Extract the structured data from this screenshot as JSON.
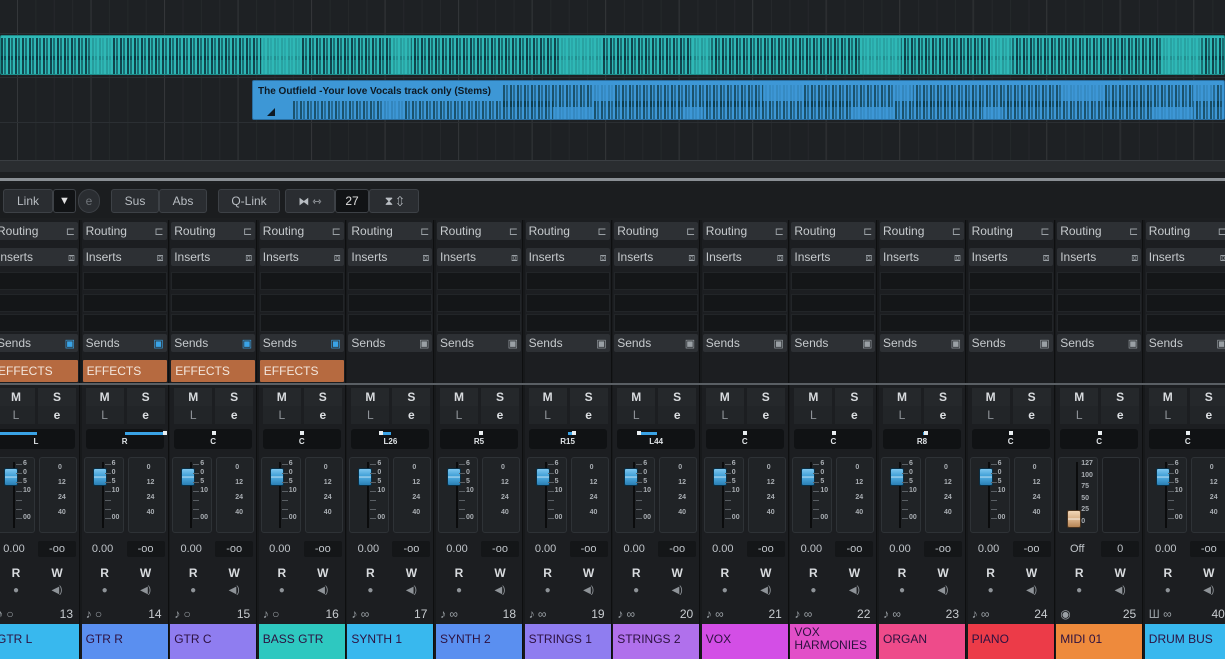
{
  "arrange": {
    "clip2_title": "The Outfield -Your love Vocals track only (Stems)"
  },
  "toolbar": {
    "link_label": "Link",
    "dropdown_glyph": "▼",
    "chain_glyph": "e",
    "sus_label": "Sus",
    "abs_label": "Abs",
    "qlink_label": "Q-Link",
    "width_value": "27"
  },
  "labels": {
    "routing": "Routing",
    "inserts": "Inserts",
    "sends": "Sends",
    "mute": "M",
    "solo": "S",
    "listen": "L",
    "edit": "e",
    "read": "R",
    "write": "W",
    "effects": "EFFECTS"
  },
  "colors": {
    "accent": "#3aa3e6",
    "effects": "#b66a40"
  },
  "fader_ticks": [
    "6",
    "0",
    "5",
    "10",
    "",
    "",
    "00"
  ],
  "meter_ticks": [
    "0",
    "12",
    "24",
    "40"
  ],
  "midi_ticks": [
    "127",
    "100",
    "75",
    "50",
    "25",
    "0"
  ],
  "channels": [
    {
      "name": "GTR L",
      "number": "13",
      "pan": "L",
      "volume": "0.00",
      "peak": "-oo",
      "color": "#38b8ee",
      "effects": true,
      "icon": "audio"
    },
    {
      "name": "GTR R",
      "number": "14",
      "pan": "R",
      "volume": "0.00",
      "peak": "-oo",
      "color": "#5a8ff0",
      "effects": true,
      "icon": "audio"
    },
    {
      "name": "GTR C",
      "number": "15",
      "pan": "C",
      "volume": "0.00",
      "peak": "-oo",
      "color": "#8f7df0",
      "effects": true,
      "icon": "audio"
    },
    {
      "name": "BASS GTR",
      "number": "16",
      "pan": "C",
      "volume": "0.00",
      "peak": "-oo",
      "color": "#2ec8c0",
      "effects": true,
      "icon": "audio"
    },
    {
      "name": "SYNTH 1",
      "number": "17",
      "pan": "L26",
      "volume": "0.00",
      "peak": "-oo",
      "color": "#38b8ee",
      "effects": false,
      "icon": "audio-stereo"
    },
    {
      "name": "SYNTH 2",
      "number": "18",
      "pan": "R5",
      "volume": "0.00",
      "peak": "-oo",
      "color": "#5a8ff0",
      "effects": false,
      "icon": "audio-stereo"
    },
    {
      "name": "STRINGS 1",
      "number": "19",
      "pan": "R15",
      "volume": "0.00",
      "peak": "-oo",
      "color": "#8f7df0",
      "effects": false,
      "icon": "audio-stereo"
    },
    {
      "name": "STRINGS 2",
      "number": "20",
      "pan": "L44",
      "volume": "0.00",
      "peak": "-oo",
      "color": "#b070ec",
      "effects": false,
      "icon": "audio-stereo"
    },
    {
      "name": "VOX",
      "number": "21",
      "pan": "C",
      "volume": "0.00",
      "peak": "-oo",
      "color": "#d34ee6",
      "effects": false,
      "icon": "audio-stereo"
    },
    {
      "name": "VOX HARMONIES",
      "number": "22",
      "pan": "C",
      "volume": "0.00",
      "peak": "-oo",
      "color": "#e24fc8",
      "effects": false,
      "icon": "audio-stereo"
    },
    {
      "name": "ORGAN",
      "number": "23",
      "pan": "R8",
      "volume": "0.00",
      "peak": "-oo",
      "color": "#ee4b8a",
      "effects": false,
      "icon": "audio-stereo"
    },
    {
      "name": "PIANO",
      "number": "24",
      "pan": "C",
      "volume": "0.00",
      "peak": "-oo",
      "color": "#ec3b48",
      "effects": false,
      "icon": "audio-stereo"
    },
    {
      "name": "MIDI 01",
      "number": "25",
      "pan": "C",
      "volume": "Off",
      "peak": "0",
      "color": "#ee8a3c",
      "effects": false,
      "icon": "midi"
    },
    {
      "name": "DRUM BUS",
      "number": "40",
      "pan": "C",
      "volume": "0.00",
      "peak": "-oo",
      "color": "#38b8ee",
      "effects": false,
      "icon": "group"
    }
  ]
}
